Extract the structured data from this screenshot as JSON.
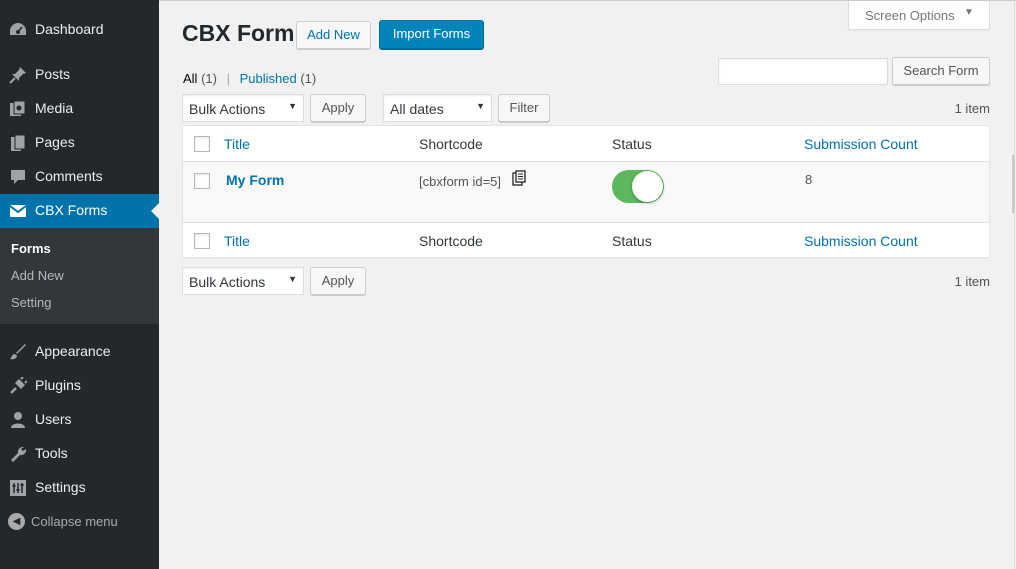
{
  "sidebar": {
    "items": [
      {
        "label": "Dashboard",
        "icon": "dashboard-icon"
      },
      {
        "label": "Posts",
        "icon": "pin-icon"
      },
      {
        "label": "Media",
        "icon": "media-icon"
      },
      {
        "label": "Pages",
        "icon": "pages-icon"
      },
      {
        "label": "Comments",
        "icon": "comment-icon"
      },
      {
        "label": "CBX Forms",
        "icon": "envelope-icon"
      },
      {
        "label": "Appearance",
        "icon": "brush-icon"
      },
      {
        "label": "Plugins",
        "icon": "plug-icon"
      },
      {
        "label": "Users",
        "icon": "user-icon"
      },
      {
        "label": "Tools",
        "icon": "wrench-icon"
      },
      {
        "label": "Settings",
        "icon": "settings-icon"
      }
    ],
    "submenu": [
      "Forms",
      "Add New",
      "Setting"
    ],
    "collapse_label": "Collapse menu"
  },
  "header": {
    "screen_options": "Screen Options",
    "title": "CBX Form",
    "add_new": "Add New",
    "import": "Import Forms"
  },
  "filters": {
    "all": "All",
    "all_count": "(1)",
    "published": "Published",
    "published_count": "(1)"
  },
  "search": {
    "button": "Search Form",
    "value": ""
  },
  "tablenav": {
    "bulk": "Bulk Actions",
    "apply": "Apply",
    "dates": "All dates",
    "filter": "Filter",
    "count": "1 item"
  },
  "table": {
    "columns": [
      "Title",
      "Shortcode",
      "Status",
      "Submission Count"
    ],
    "rows": [
      {
        "title": "My Form",
        "shortcode": "[cbxform id=5]",
        "status": "on",
        "count": "8"
      }
    ]
  },
  "colors": {
    "accent": "#0073aa",
    "toggle_on": "#5cb85c",
    "sidebar": "#23282d"
  }
}
